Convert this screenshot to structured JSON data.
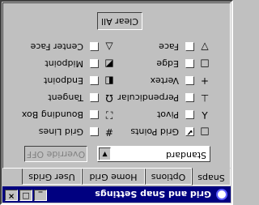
{
  "window": {
    "title": "Grid and Snap Settings",
    "controls": [
      "_",
      "□",
      "×"
    ]
  },
  "tabs": [
    {
      "label": "Snaps",
      "active": true
    },
    {
      "label": "Options",
      "active": false
    },
    {
      "label": "Home Grid",
      "active": false
    },
    {
      "label": "User Grids",
      "active": false
    }
  ],
  "mode_select": {
    "value": "Standard"
  },
  "override_button": {
    "label": "Override OFF"
  },
  "snaps": [
    {
      "label": "Grid Points",
      "symbol": "□",
      "checked": true
    },
    {
      "label": "Grid Lines",
      "symbol": "#",
      "checked": false
    },
    {
      "label": "Pivot",
      "symbol": "⅄",
      "checked": false
    },
    {
      "label": "Bounding Box",
      "symbol": "⛶",
      "checked": false
    },
    {
      "label": "Perpendicular",
      "symbol": "⊥",
      "checked": false
    },
    {
      "label": "Tangent",
      "symbol": "Ω",
      "checked": false
    },
    {
      "label": "Vertex",
      "symbol": "+",
      "checked": false
    },
    {
      "label": "Endpoint",
      "symbol": "◧",
      "checked": false
    },
    {
      "label": "Edge",
      "symbol": "□",
      "checked": false
    },
    {
      "label": "Midpoint",
      "symbol": "◩",
      "checked": false
    },
    {
      "label": "Face",
      "symbol": "▽",
      "checked": false
    },
    {
      "label": "Center Face",
      "symbol": "△",
      "checked": false
    }
  ],
  "clear_all_button": {
    "label": "Clear All"
  },
  "colors": {
    "titlebar": "#000080",
    "face": "#c0c0c0"
  }
}
